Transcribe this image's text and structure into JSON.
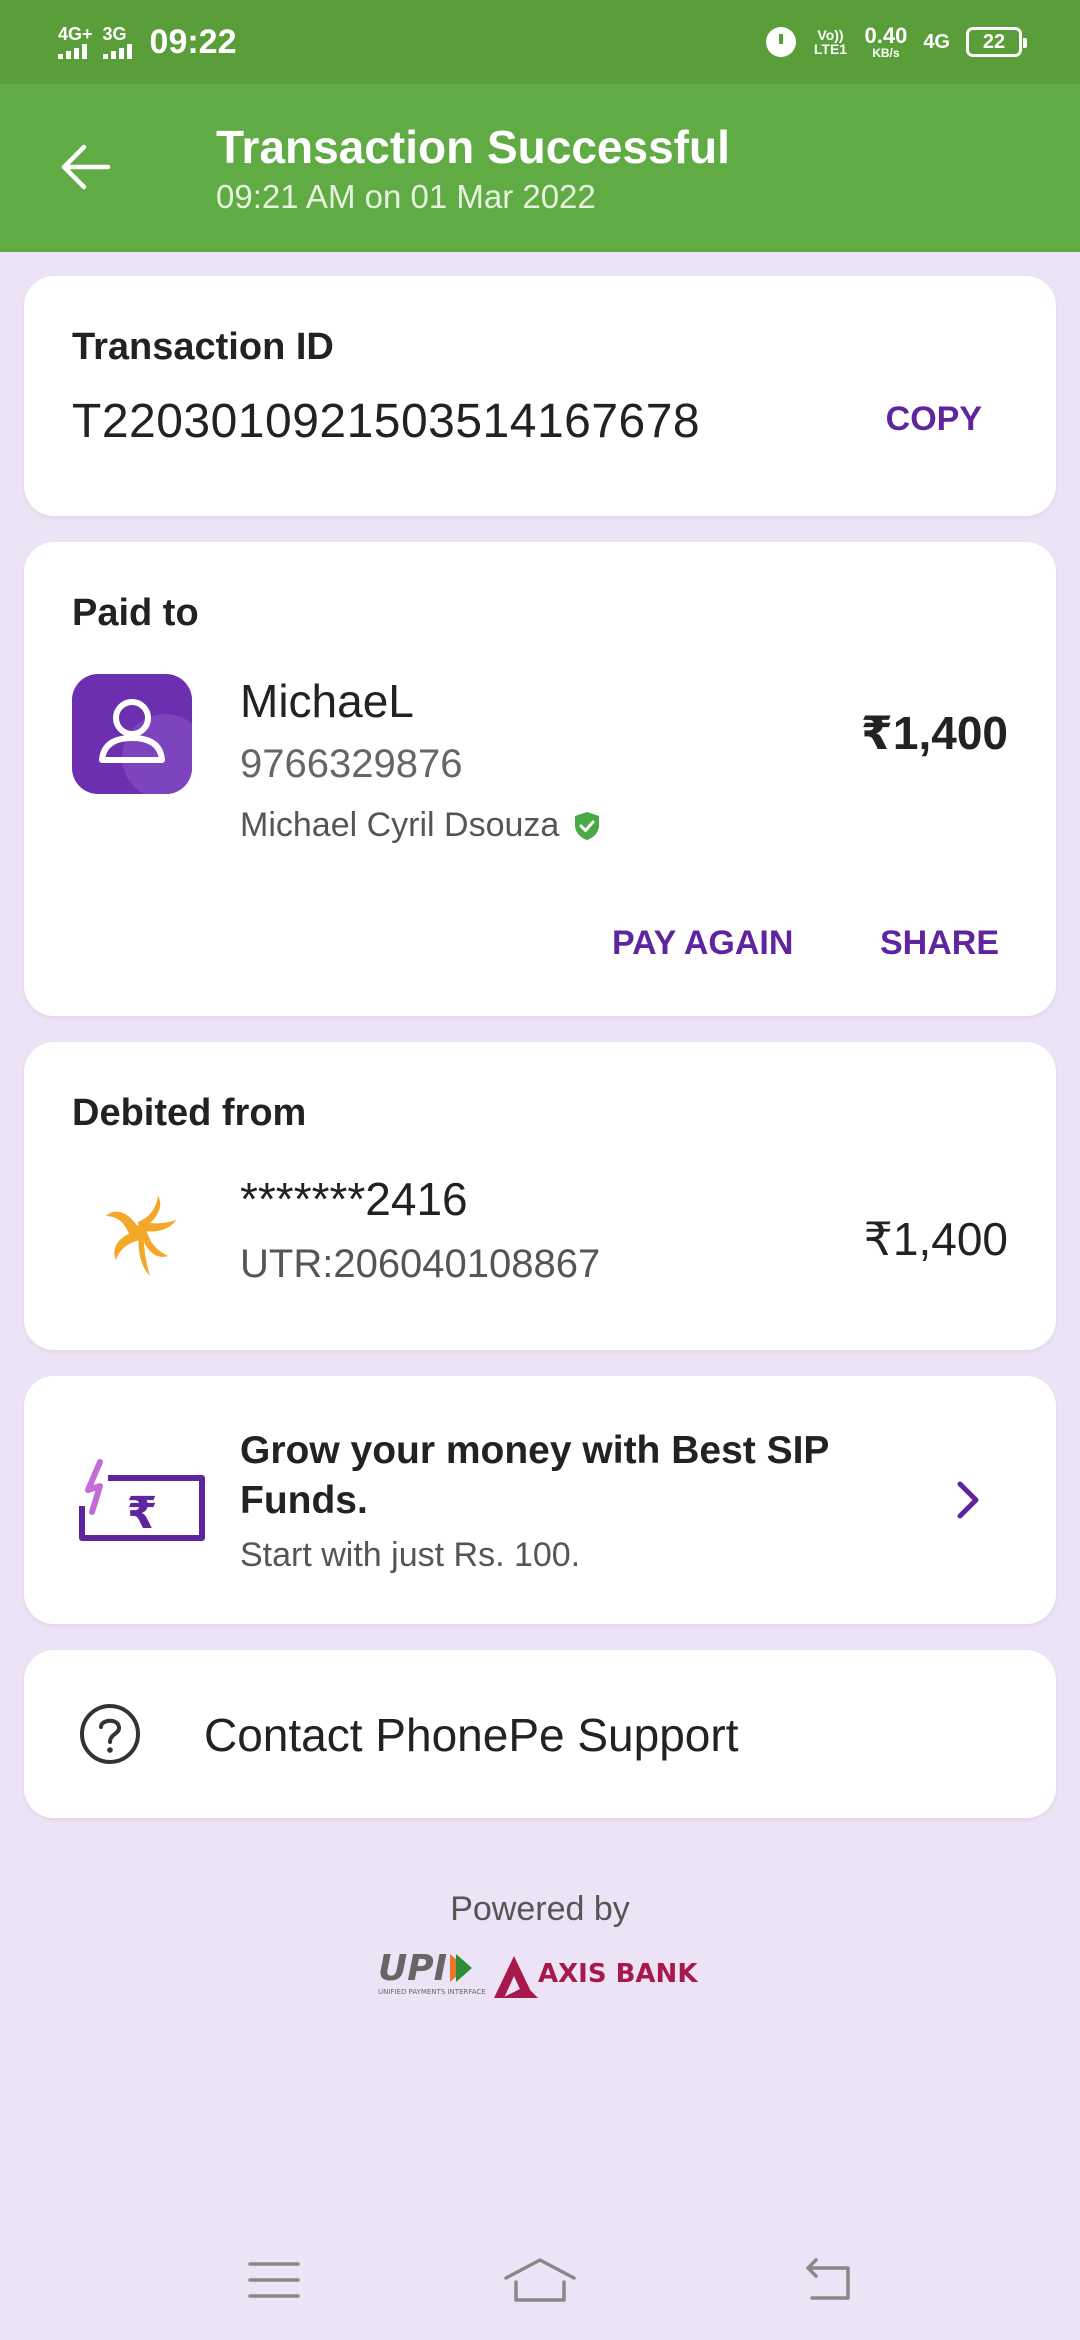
{
  "status_bar": {
    "sim1": "4G+",
    "sim2": "3G",
    "time": "09:22",
    "volte": "Vo)) LTE1",
    "speed_value": "0.40",
    "speed_unit": "KB/s",
    "network": "4G",
    "battery": "22"
  },
  "header": {
    "title": "Transaction Successful",
    "subtitle": "09:21 AM on 01 Mar 2022",
    "back_icon": "arrow-left-icon"
  },
  "transaction": {
    "label": "Transaction ID",
    "id": "T2203010921503514167678",
    "copy_label": "COPY"
  },
  "paid_to": {
    "label": "Paid to",
    "name": "MichaeL",
    "phone": "9766329876",
    "full_name": "Michael Cyril Dsouza",
    "amount": "₹1,400",
    "pay_again_label": "PAY AGAIN",
    "share_label": "SHARE"
  },
  "debited_from": {
    "label": "Debited from",
    "account": "*******2416",
    "utr": "UTR:206040108867",
    "amount": "₹1,400"
  },
  "promo": {
    "title": "Grow your money with Best SIP Funds.",
    "subtitle": "Start with just Rs. 100."
  },
  "support": {
    "label": "Contact PhonePe Support"
  },
  "footer": {
    "powered_by": "Powered by",
    "logo_upi": "UPI",
    "logo_upi_sub": "UNIFIED PAYMENTS INTERFACE",
    "logo_bank": "AXIS BANK"
  },
  "colors": {
    "status_bar": "#5a9e3a",
    "header": "#61ab45",
    "accent": "#5f259f",
    "background": "#ece4f6"
  }
}
